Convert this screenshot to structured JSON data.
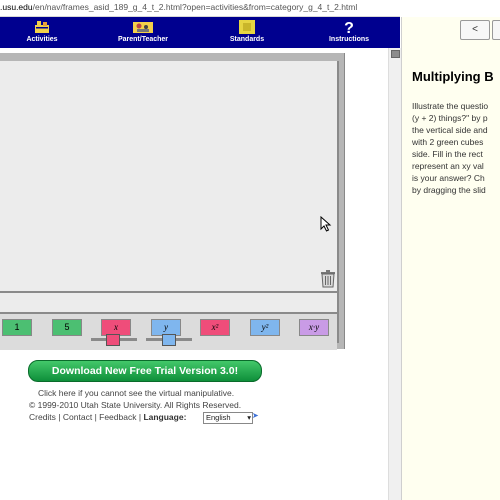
{
  "address_bar": {
    "domain": ".usu.edu",
    "path": "/en/nav/frames_asid_189_g_4_t_2.html?open=activities&from=category_g_4_t_2.html"
  },
  "nav": {
    "items": [
      {
        "label": "Activities",
        "icon": "activities-icon"
      },
      {
        "label": "Parent/Teacher",
        "icon": "parent-teacher-icon"
      },
      {
        "label": "Standards",
        "icon": "standards-icon"
      },
      {
        "label": "Instructions",
        "icon": "question-mark-icon"
      }
    ]
  },
  "tools": {
    "buttons": [
      "1",
      "5",
      "x",
      "y",
      "x²",
      "y²",
      "x·y"
    ]
  },
  "footer": {
    "download_label": "Download New Free Trial Version 3.0!",
    "help_text": "Click here if you cannot see the virtual manipulative.",
    "copyright": "© 1999-2010 Utah State University. All Rights Reserved.",
    "links": [
      "Credits",
      "Contact",
      "Feedback"
    ],
    "language_label": "Language:",
    "language_value": "English"
  },
  "right": {
    "prev_label": "<",
    "title": "Multiplying B",
    "lines": [
      "Illustrate the questio",
      "(y + 2) things?\" by p",
      "the vertical side and",
      "with 2 green cubes",
      "side. Fill in the rect",
      "represent an xy val",
      "is your answer? Ch",
      "by dragging the slid"
    ]
  },
  "colors": {
    "nav_bg": "#00008f",
    "download_green": "#1aa64b",
    "tile_green": "#4cbf72",
    "tile_red": "#ef4d7a",
    "tile_blue": "#7fb6ee",
    "tile_purple": "#c99be6"
  }
}
